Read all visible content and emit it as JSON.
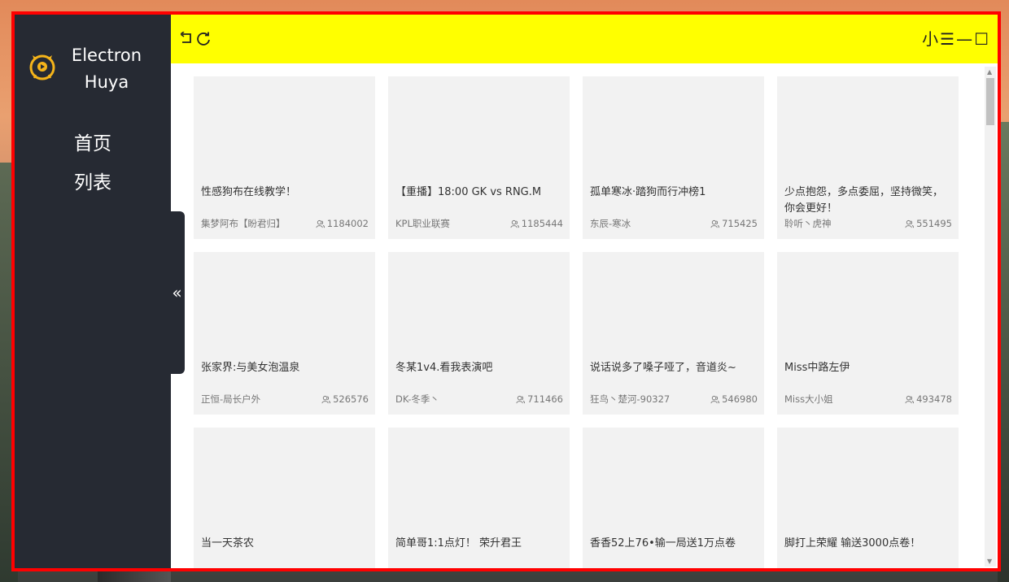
{
  "app": {
    "title": "Electron\nHuya",
    "logo_icon": "huya-logo-icon",
    "accent": "#ffff00",
    "sidebar_bg": "#262a33",
    "border_color": "#ff0000"
  },
  "sidebar": {
    "items": [
      {
        "label": "首页"
      },
      {
        "label": "列表"
      }
    ],
    "collapse_label": "«"
  },
  "toolbar": {
    "back_icon": "back-icon",
    "refresh_icon": "refresh-icon",
    "window_controls": [
      {
        "label": "小",
        "name": "mini-mode-button"
      },
      {
        "label": "☰",
        "name": "menu-button"
      },
      {
        "label": "—",
        "name": "minimize-button"
      },
      {
        "label": "☐",
        "name": "maximize-button"
      }
    ]
  },
  "rooms": [
    {
      "title": "性感狗布在线教学！",
      "host": "集梦阿布【盼君归】",
      "viewers": "1184002"
    },
    {
      "title": "【重播】18:00 GK vs RNG.M",
      "host": "KPL职业联赛",
      "viewers": "1185444"
    },
    {
      "title": "孤单寒冰·踏狗而行冲榜1",
      "host": "东辰-寒冰",
      "viewers": "715425"
    },
    {
      "title": "少点抱怨，多点委屈，坚持微笑，你会更好！",
      "host": "聆听丶虎神",
      "viewers": "551495"
    },
    {
      "title": "张家界:与美女泡温泉",
      "host": "正恒-局长户外",
      "viewers": "526576"
    },
    {
      "title": "冬某1v4.看我表演吧",
      "host": "DK-冬季丶",
      "viewers": "711466"
    },
    {
      "title": "说话说多了嗓子哑了，音道炎~",
      "host": "狂鸟丶楚河-90327",
      "viewers": "546980"
    },
    {
      "title": "Miss中路左伊",
      "host": "Miss大小姐",
      "viewers": "493478"
    },
    {
      "title": "当一天茶农",
      "host": "",
      "viewers": ""
    },
    {
      "title": "简单哥1:1点灯！ 荣升君王",
      "host": "",
      "viewers": ""
    },
    {
      "title": "香香52上76•输一局送1万点卷",
      "host": "",
      "viewers": ""
    },
    {
      "title": "脚打上荣耀 输送3000点卷！",
      "host": "",
      "viewers": ""
    }
  ]
}
